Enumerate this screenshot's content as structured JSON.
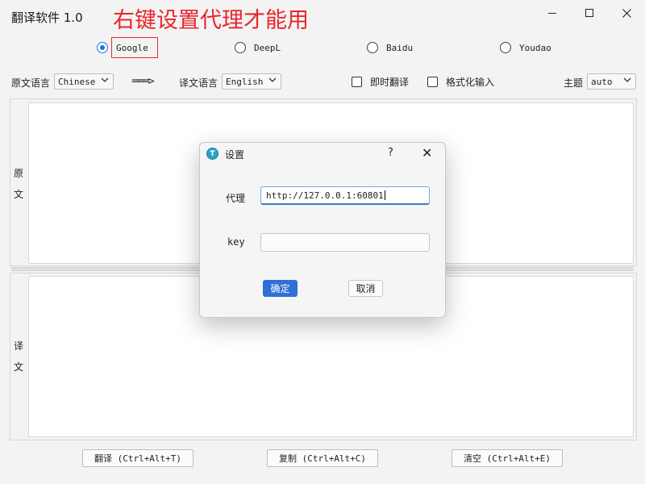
{
  "window": {
    "title": "翻译软件 1.0",
    "annotation": "右键设置代理才能用"
  },
  "engines": [
    {
      "label": "Google",
      "selected": true
    },
    {
      "label": "DeepL",
      "selected": false
    },
    {
      "label": "Baidu",
      "selected": false
    },
    {
      "label": "Youdao",
      "selected": false
    }
  ],
  "languages": {
    "source_label": "原文语言",
    "source_value": "Chinese",
    "arrow": "═══>",
    "target_label": "译文语言",
    "target_value": "English"
  },
  "options": {
    "instant_translate_label": "即时翻译",
    "instant_translate_checked": false,
    "formatted_input_label": "格式化输入",
    "formatted_input_checked": false,
    "theme_label": "主题",
    "theme_value": "auto"
  },
  "panes": {
    "source_char1": "原",
    "source_char2": "文",
    "target_char1": "译",
    "target_char2": "文"
  },
  "buttons": {
    "translate": "翻译 (Ctrl+Alt+T)",
    "copy": "复制 (Ctrl+Alt+C)",
    "clear": "清空 (Ctrl+Alt+E)"
  },
  "dialog": {
    "icon_letter": "T",
    "title": "设置",
    "help": "?",
    "close": "✕",
    "proxy_label": "代理",
    "proxy_value": "http://127.0.0.1:60801",
    "key_label": "key",
    "key_value": "",
    "ok_label": "确定",
    "cancel_label": "取消"
  },
  "colors": {
    "accent": "#1a73e8",
    "annotation": "#e8262d",
    "ok_button": "#2f6fd6"
  }
}
